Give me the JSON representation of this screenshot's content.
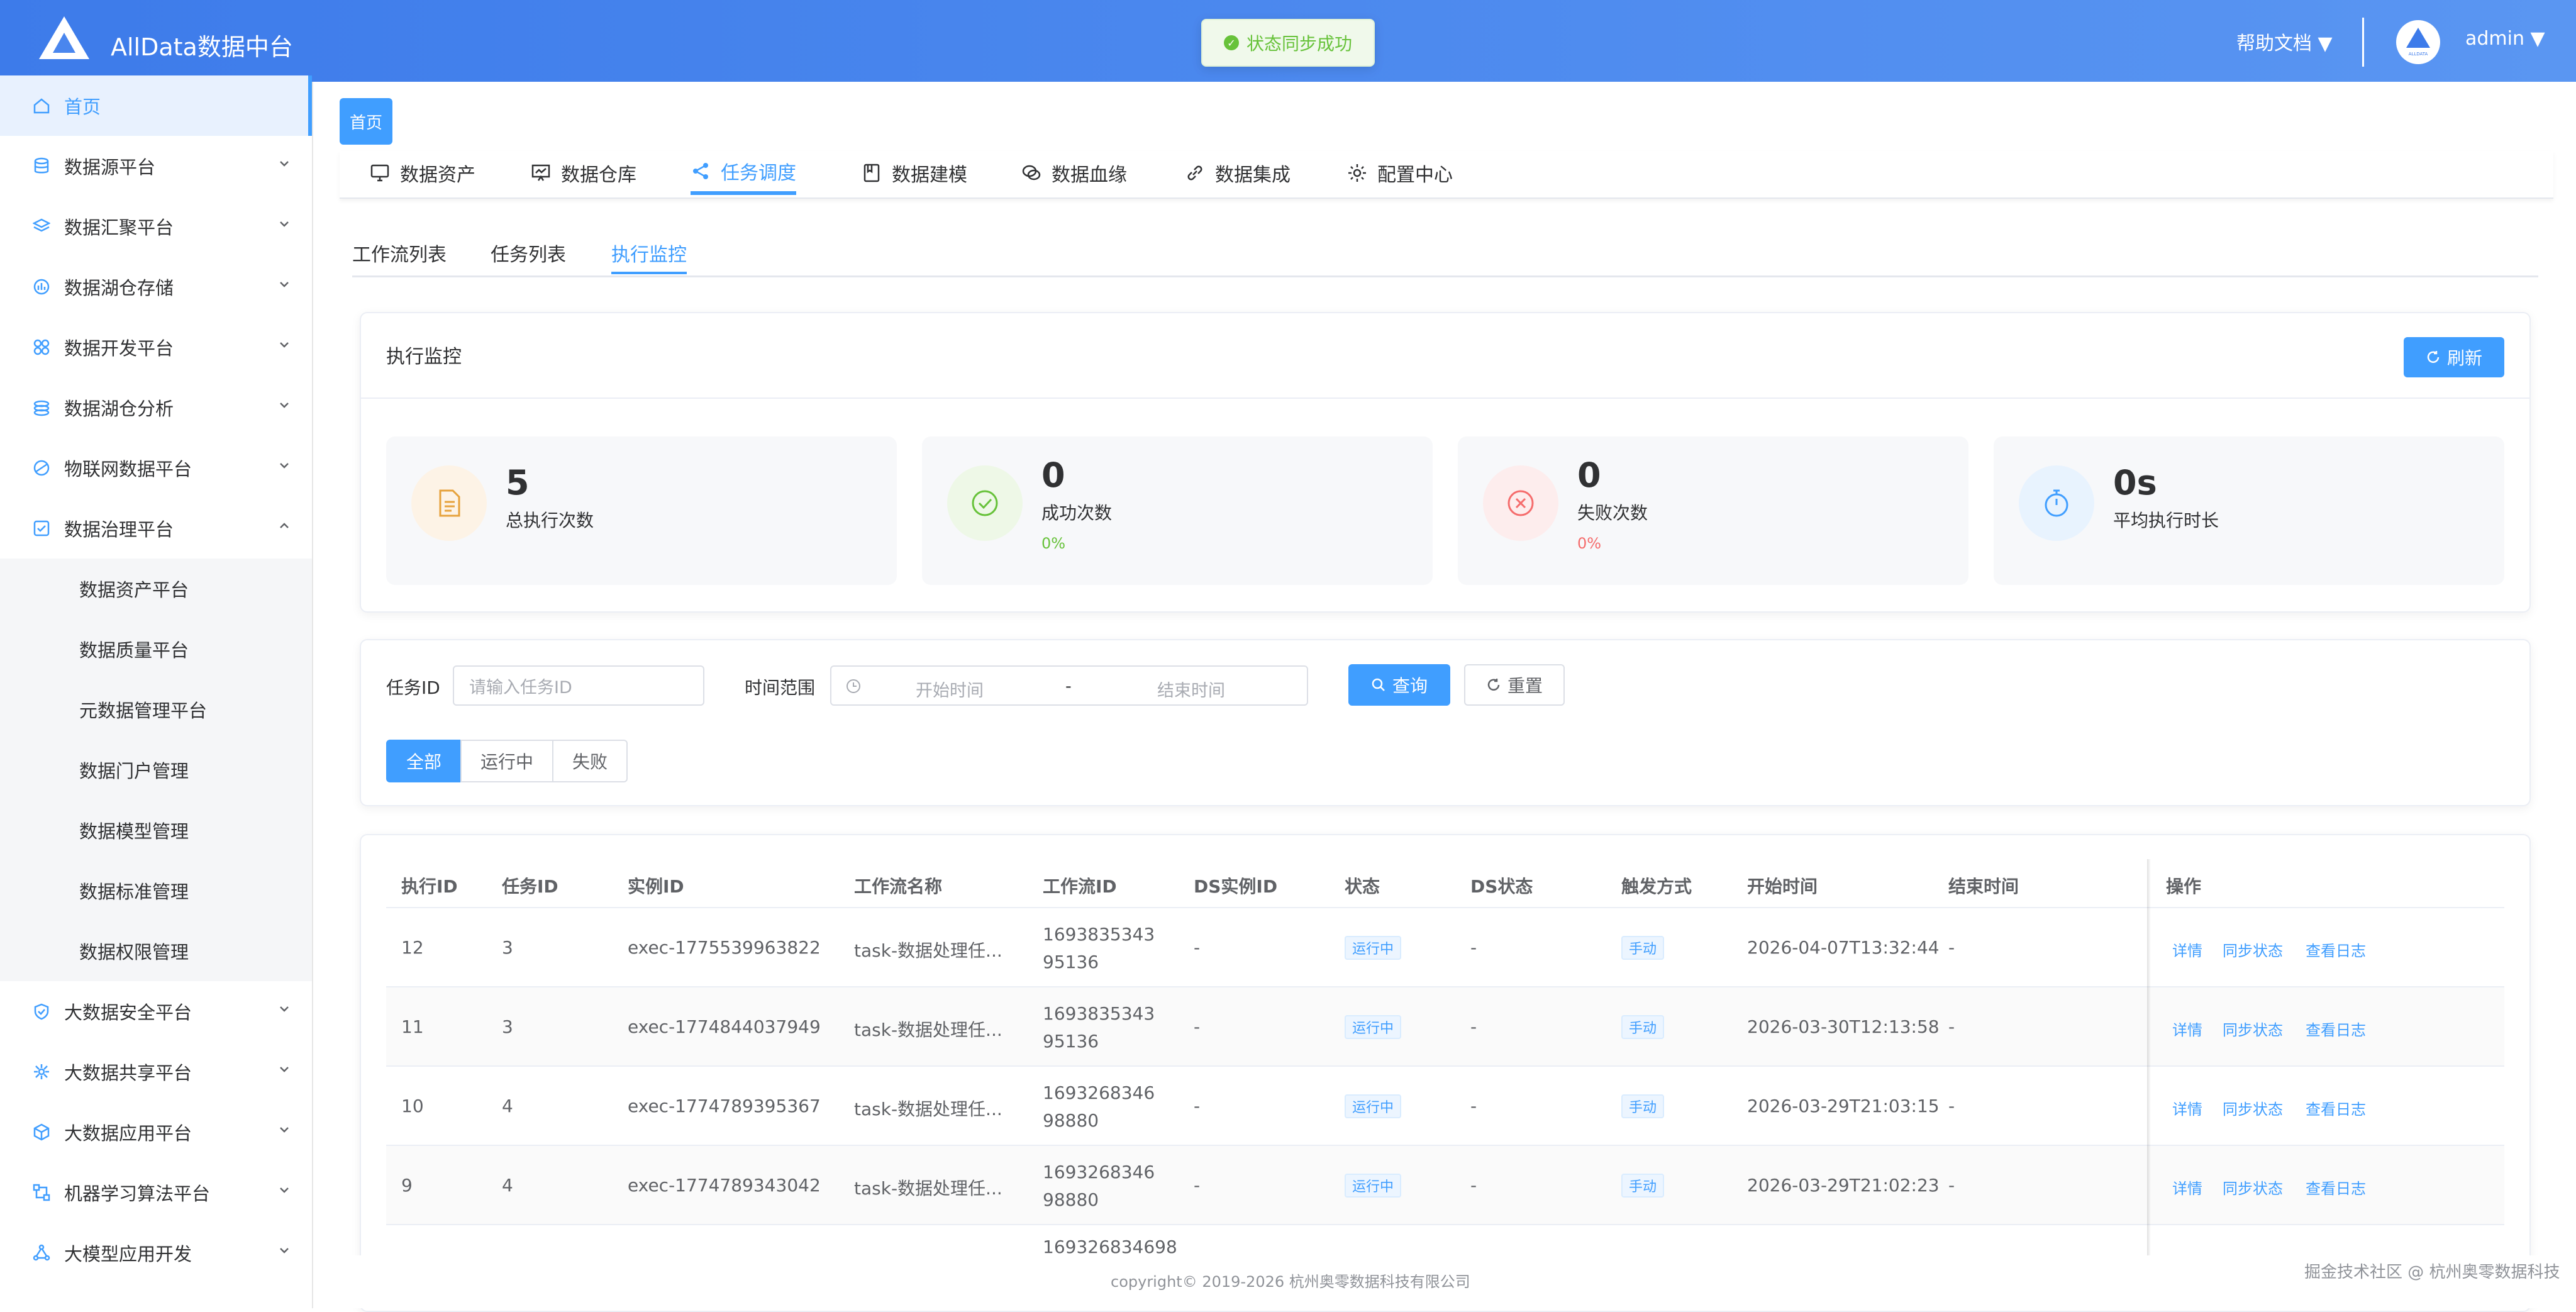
{
  "app": {
    "title": "AllData数据中台"
  },
  "toast": {
    "message": "状态同步成功"
  },
  "topbar": {
    "help": "帮助文档 ▼",
    "user": "admin ▼",
    "avatar_text": "ALLDATA"
  },
  "sidebar": {
    "items": [
      {
        "label": "首页",
        "icon": "home-icon"
      },
      {
        "label": "数据源平台",
        "icon": "database-icon"
      },
      {
        "label": "数据汇聚平台",
        "icon": "layers-icon"
      },
      {
        "label": "数据湖仓存储",
        "icon": "bar-chart-icon"
      },
      {
        "label": "数据开发平台",
        "icon": "grid-icon"
      },
      {
        "label": "数据湖仓分析",
        "icon": "analysis-icon"
      },
      {
        "label": "物联网数据平台",
        "icon": "globe-icon"
      },
      {
        "label": "数据治理平台",
        "icon": "governance-icon"
      }
    ],
    "sub_items": [
      "数据资产平台",
      "数据质量平台",
      "元数据管理平台",
      "数据门户管理",
      "数据模型管理",
      "数据标准管理",
      "数据权限管理"
    ],
    "items_bottom": [
      {
        "label": "大数据安全平台",
        "icon": "shield-icon"
      },
      {
        "label": "大数据共享平台",
        "icon": "share-icon"
      },
      {
        "label": "大数据应用平台",
        "icon": "cube-icon"
      },
      {
        "label": "机器学习算法平台",
        "icon": "ml-icon"
      },
      {
        "label": "大模型应用开发",
        "icon": "llm-icon"
      }
    ]
  },
  "breadcrumb": {
    "home": "首页"
  },
  "modules": [
    "数据资产",
    "数据仓库",
    "任务调度",
    "数据建模",
    "数据血缘",
    "数据集成",
    "配置中心"
  ],
  "sub_tabs": [
    "工作流列表",
    "任务列表",
    "执行监控"
  ],
  "monitor": {
    "title": "执行监控",
    "refresh": "刷新",
    "stats": [
      {
        "value": "5",
        "label": "总执行次数",
        "pct": ""
      },
      {
        "value": "0",
        "label": "成功次数",
        "pct": "0%"
      },
      {
        "value": "0",
        "label": "失败次数",
        "pct": "0%"
      },
      {
        "value": "0s",
        "label": "平均执行时长",
        "pct": ""
      }
    ]
  },
  "filters": {
    "task_id_label": "任务ID",
    "task_id_placeholder": "请输入任务ID",
    "time_label": "时间范围",
    "start_placeholder": "开始时间",
    "range_sep": "-",
    "end_placeholder": "结束时间",
    "query": "查询",
    "reset": "重置",
    "segments": [
      "全部",
      "运行中",
      "失败"
    ]
  },
  "table": {
    "headers": [
      "执行ID",
      "任务ID",
      "实例ID",
      "工作流名称",
      "工作流ID",
      "DS实例ID",
      "状态",
      "DS状态",
      "触发方式",
      "开始时间",
      "结束时间",
      "操作"
    ],
    "rows": [
      {
        "exec_id": "12",
        "task_id": "3",
        "instance_id": "exec-1775539963822",
        "workflow_name": "task-数据处理任...",
        "workflow_id": "169383534395136",
        "ds_instance": "-",
        "status": "运行中",
        "ds_status": "-",
        "trigger": "手动",
        "start": "2026-04-07T13:32:44",
        "end": "-"
      },
      {
        "exec_id": "11",
        "task_id": "3",
        "instance_id": "exec-1774844037949",
        "workflow_name": "task-数据处理任...",
        "workflow_id": "169383534395136",
        "ds_instance": "-",
        "status": "运行中",
        "ds_status": "-",
        "trigger": "手动",
        "start": "2026-03-30T12:13:58",
        "end": "-"
      },
      {
        "exec_id": "10",
        "task_id": "4",
        "instance_id": "exec-1774789395367",
        "workflow_name": "task-数据处理任...",
        "workflow_id": "169326834698880",
        "ds_instance": "-",
        "status": "运行中",
        "ds_status": "-",
        "trigger": "手动",
        "start": "2026-03-29T21:03:15",
        "end": "-"
      },
      {
        "exec_id": "9",
        "task_id": "4",
        "instance_id": "exec-1774789343042",
        "workflow_name": "task-数据处理任...",
        "workflow_id": "169326834698880",
        "ds_instance": "-",
        "status": "运行中",
        "ds_status": "-",
        "trigger": "手动",
        "start": "2026-03-29T21:02:23",
        "end": "-"
      }
    ],
    "partial_row_workflow_id": "169326834698",
    "actions": [
      "详情",
      "同步状态",
      "查看日志"
    ]
  },
  "footer": {
    "copyright": "copyright© 2019-2026 杭州奥零数据科技有限公司",
    "watermark": "掘金技术社区 @ 杭州奥零数据科技"
  },
  "colors": {
    "primary": "#409eff",
    "header": "#4a86ee",
    "success": "#67c23a",
    "danger": "#f56c6c",
    "warning": "#e6a23c"
  }
}
